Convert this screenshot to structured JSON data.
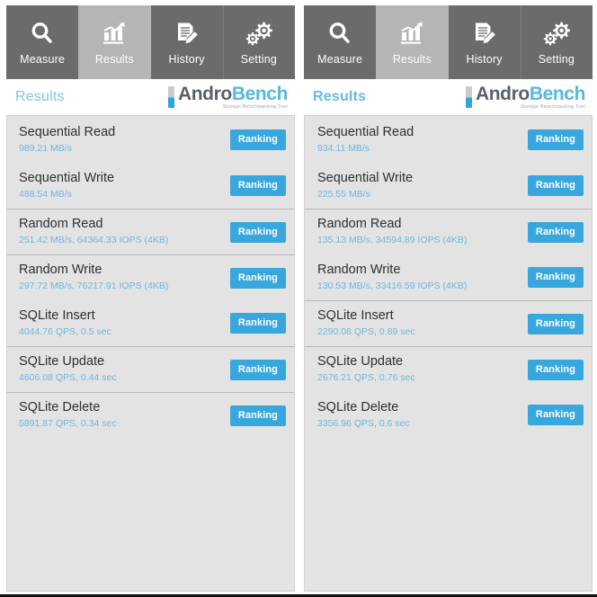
{
  "app": {
    "logo": {
      "name_part1": "Andro",
      "name_part2": "Bench",
      "tagline": "Storage Benchmarking Tool",
      "mark_icon": "androbench-logo-bar"
    },
    "accent_color": "#38a7dd",
    "tab_active_bg": "#b5b5b5",
    "tab_bg": "#6b6b6b",
    "list_bg": "#e3e3e3",
    "value_color": "#6fb6df",
    "title_color": "#7ec4e8"
  },
  "tabs": [
    {
      "label": "Measure",
      "icon": "magnifier-icon",
      "active": false
    },
    {
      "label": "Results",
      "icon": "bar-chart-icon",
      "active": true
    },
    {
      "label": "History",
      "icon": "document-pencil-icon",
      "active": false
    },
    {
      "label": "Setting",
      "icon": "gears-icon",
      "active": false
    }
  ],
  "panels": [
    {
      "title": "Results",
      "rows": [
        {
          "name": "Sequential Read",
          "value": "989.21 MB/s",
          "button": "Ranking",
          "separator": false
        },
        {
          "name": "Sequential Write",
          "value": "488.54 MB/s",
          "button": "Ranking",
          "separator": false
        },
        {
          "name": "Random Read",
          "value": "251.42 MB/s, 64364.33 IOPS (4KB)",
          "button": "Ranking",
          "separator": true
        },
        {
          "name": "Random Write",
          "value": "297.72 MB/s, 76217.91 IOPS (4KB)",
          "button": "Ranking",
          "separator": true
        },
        {
          "name": "SQLite Insert",
          "value": "4044.76 QPS, 0.5 sec",
          "button": "Ranking",
          "separator": false
        },
        {
          "name": "SQLite Update",
          "value": "4606.08 QPS, 0.44 sec",
          "button": "Ranking",
          "separator": true
        },
        {
          "name": "SQLite Delete",
          "value": "5891.87 QPS, 0.34 sec",
          "button": "Ranking",
          "separator": true
        }
      ]
    },
    {
      "title": "Results",
      "rows": [
        {
          "name": "Sequential Read",
          "value": "934.11 MB/s",
          "button": "Ranking",
          "separator": false
        },
        {
          "name": "Sequential Write",
          "value": "225.55 MB/s",
          "button": "Ranking",
          "separator": false
        },
        {
          "name": "Random Read",
          "value": "135.13 MB/s, 34594.89 IOPS (4KB)",
          "button": "Ranking",
          "separator": true
        },
        {
          "name": "Random Write",
          "value": "130.53 MB/s, 33416.59 IOPS (4KB)",
          "button": "Ranking",
          "separator": false
        },
        {
          "name": "SQLite Insert",
          "value": "2290.08 QPS, 0.89 sec",
          "button": "Ranking",
          "separator": true
        },
        {
          "name": "SQLite Update",
          "value": "2676.21 QPS, 0.76 sec",
          "button": "Ranking",
          "separator": true
        },
        {
          "name": "SQLite Delete",
          "value": "3356.96 QPS, 0.6 sec",
          "button": "Ranking",
          "separator": false
        }
      ]
    }
  ]
}
